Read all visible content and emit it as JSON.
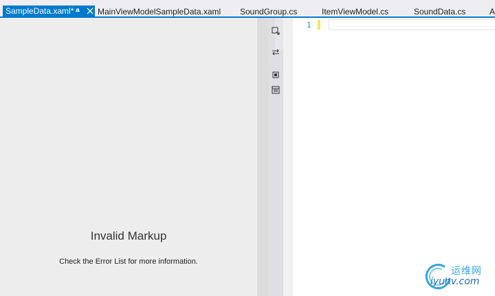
{
  "tabs": [
    {
      "label": "SampleData.xaml*",
      "active": true
    },
    {
      "label": "MainViewModelSampleData.xaml"
    },
    {
      "label": "SoundGroup.cs"
    },
    {
      "label": "ItemViewModel.cs"
    },
    {
      "label": "SoundData.cs"
    },
    {
      "label": "A"
    }
  ],
  "design_surface": {
    "message_title": "Invalid Markup",
    "message_detail": "Check the Error List for more information."
  },
  "tool_icons": [
    "zoom-to-fit-icon",
    "swap-panes-icon",
    "collapse-pane-icon",
    "split-view-icon"
  ],
  "editor": {
    "line_numbers": [
      "1"
    ]
  },
  "watermark": {
    "cn": "运维网",
    "url": "iyunv.com"
  },
  "colors": {
    "accent": "#007acc",
    "design_surface_bg": "#ededed",
    "line_number": "#2b91af",
    "change_marker": "#f5e55a"
  }
}
